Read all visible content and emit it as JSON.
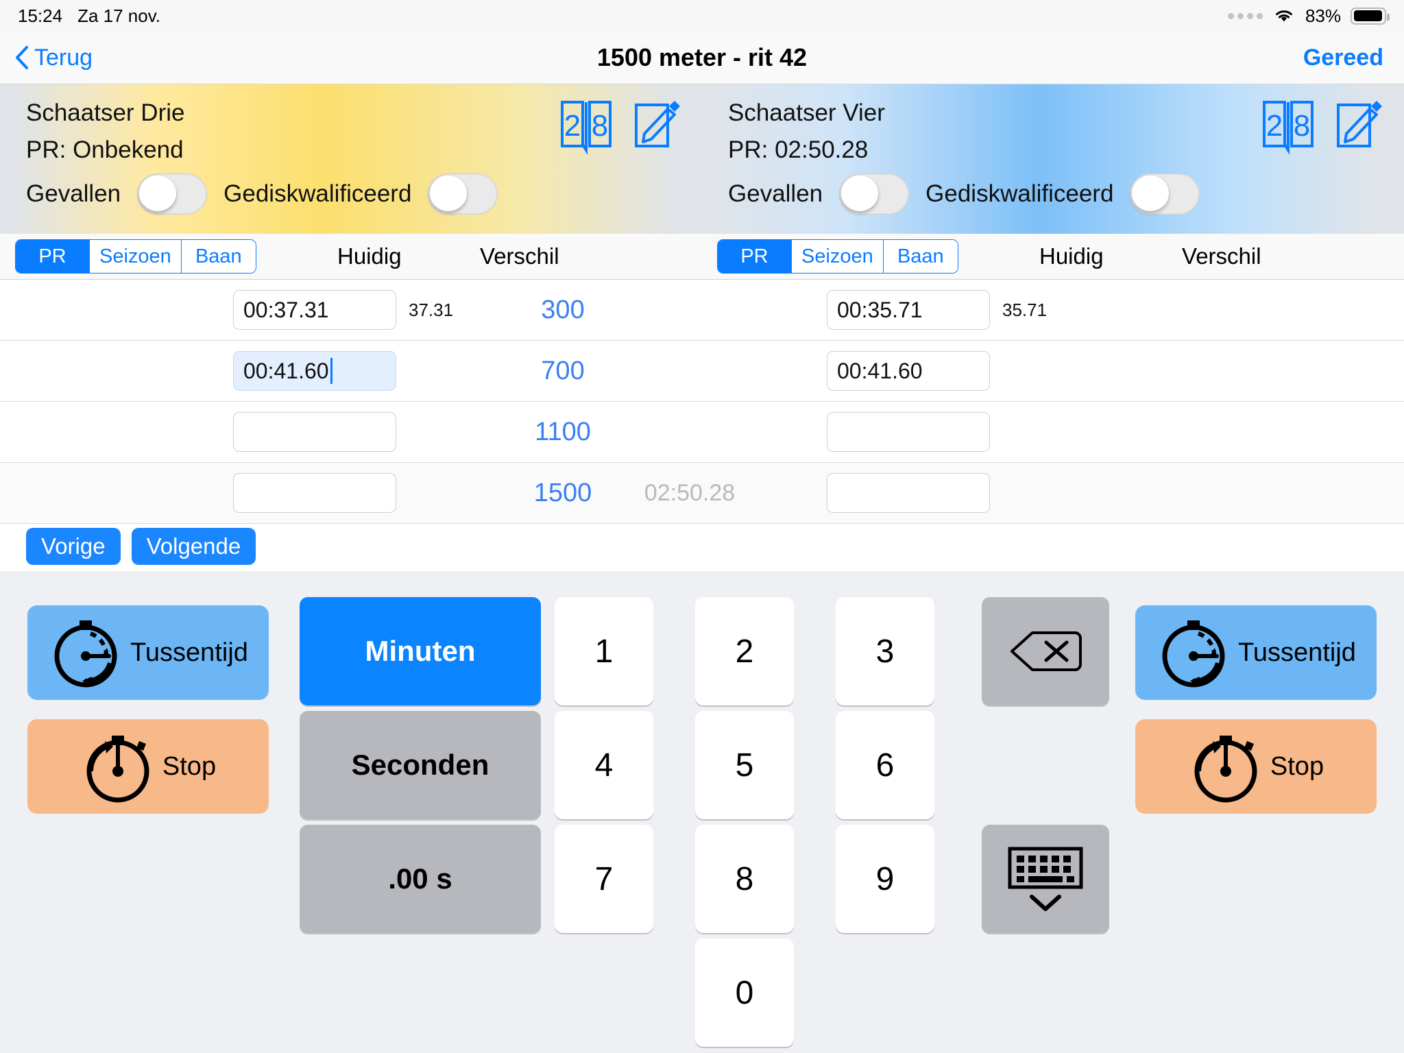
{
  "status_bar": {
    "time": "15:24",
    "date": "Za 17 nov.",
    "battery_percent": "83%",
    "wifi_icon": "wifi-icon",
    "battery_icon": "battery-icon",
    "signal_icon": "signal-dots-icon"
  },
  "nav": {
    "back_label": "Terug",
    "title": "1500 meter - rit 42",
    "done_label": "Gereed",
    "back_icon": "chevron-left-icon"
  },
  "skaters": [
    {
      "name": "Schaatser Drie",
      "pr_label": "PR: Onbekend",
      "fallen_label": "Gevallen",
      "fallen_on": false,
      "disqualified_label": "Gediskwalificeerd",
      "disqualified_on": false,
      "book_icon": "book-28-icon",
      "edit_icon": "pencil-edit-icon",
      "book_icon_number": "28"
    },
    {
      "name": "Schaatser Vier",
      "pr_label": "PR: 02:50.28",
      "fallen_label": "Gevallen",
      "fallen_on": false,
      "disqualified_label": "Gediskwalificeerd",
      "disqualified_on": false,
      "book_icon": "book-28-icon",
      "edit_icon": "pencil-edit-icon",
      "book_icon_number": "28"
    }
  ],
  "segmented": {
    "options": [
      "PR",
      "Seizoen",
      "Baan"
    ],
    "selected": "PR",
    "col_current": "Huidig",
    "col_difference": "Verschil"
  },
  "table": {
    "rows": [
      {
        "distance": "300",
        "left_time": "00:37.31",
        "left_diff": "37.31",
        "left_focused": false,
        "right_time": "00:35.71",
        "right_diff": "35.71",
        "pr_time": ""
      },
      {
        "distance": "700",
        "left_time": "00:41.60",
        "left_diff": "",
        "left_focused": true,
        "right_time": "00:41.60",
        "right_diff": "",
        "pr_time": ""
      },
      {
        "distance": "1100",
        "left_time": "",
        "left_diff": "",
        "left_focused": false,
        "right_time": "",
        "right_diff": "",
        "pr_time": ""
      },
      {
        "distance": "1500",
        "left_time": "",
        "left_diff": "",
        "left_focused": false,
        "right_time": "",
        "right_diff": "",
        "pr_time": "02:50.28"
      }
    ]
  },
  "pills": {
    "previous": "Vorige",
    "next": "Volgende"
  },
  "keyboard": {
    "minutes": "Minuten",
    "seconds": "Seconden",
    "hundredths": ".00 s",
    "digits": [
      "1",
      "2",
      "3",
      "4",
      "5",
      "6",
      "7",
      "8",
      "9",
      "0"
    ],
    "backspace_icon": "backspace-delete-icon",
    "dismiss_icon": "hide-keyboard-icon",
    "left_lap": "Tussentijd",
    "left_stop": "Stop",
    "right_lap": "Tussentijd",
    "right_stop": "Stop",
    "lap_icon": "stopwatch-lap-icon",
    "stop_icon": "stopwatch-stop-icon"
  },
  "colors": {
    "accent_blue": "#0a7cff",
    "key_blue": "#0a84ff",
    "lap_blue": "#6cb6f5",
    "stop_orange": "#f8b98a",
    "distance_blue": "#3b7ff0",
    "skater_left_tint": "#fbdf6e",
    "skater_right_tint": "#7dc0f7"
  }
}
